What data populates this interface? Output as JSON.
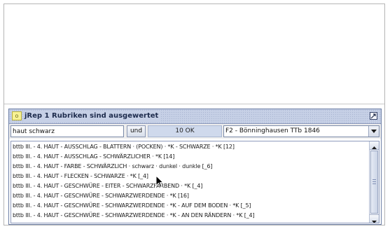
{
  "window": {
    "title": "jRep 1 Rubriken sind ausgewertet"
  },
  "toolbar": {
    "search_value": "haut schwarz",
    "und_label": "und",
    "status_text": "10 OK",
    "repertory_selected": "F2 - Bönninghausen  TTb 1846"
  },
  "rubrics": [
    "bttb  III. - 4. HAUT - AUSSCHLAG - BLATTERN · (POCKEN) · *K - SCHWARZE · *K [12]",
    "bttb  III. - 4. HAUT - AUSSCHLAG - SCHWÄRZLICHER · *K [14]",
    "bttb  III. - 4. HAUT - FARBE - SCHWÄRZLICH · schwarz · dunkel · dunkle [_6]",
    "bttb  III. - 4. HAUT - FLECKEN - SCHWARZE · *K [_4]",
    "bttb  III. - 4. HAUT - GESCHWÜRE - EITER - SCHWARZFÄRBEND · *K [_4]",
    "bttb  III. - 4. HAUT - GESCHWÜRE - SCHWARZWERDENDE · *K [16]",
    "bttb  III. - 4. HAUT - GESCHWÜRE - SCHWARZWERDENDE · *K - AUF DEM BODEN · *K [_5]",
    "bttb  III. - 4. HAUT - GESCHWÜRE - SCHWARZWERDENDE · *K - AN DEN RÄNDERN · *K [_4]"
  ],
  "icons": {
    "window_icon": "app-window-icon",
    "maximize": "maximize-icon",
    "dropdown": "chevron-down-icon",
    "scroll_up": "scroll-up-arrow-icon",
    "scroll_down": "scroll-down-arrow-icon",
    "cursor": "mouse-pointer-icon"
  },
  "colors": {
    "titlebar": "#c6d0e6",
    "status_field": "#cfd9ec",
    "title_text": "#1d2b4c"
  }
}
